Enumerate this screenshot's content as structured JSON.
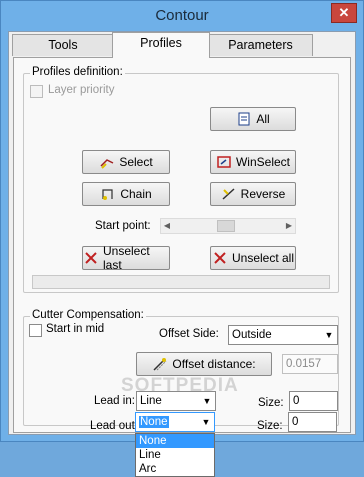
{
  "window": {
    "title": "Contour",
    "close_glyph": "✕"
  },
  "tabs": [
    {
      "label": "Tools",
      "active": false
    },
    {
      "label": "Profiles",
      "active": true
    },
    {
      "label": "Parameters",
      "active": false
    }
  ],
  "profiles": {
    "group_label": "Profiles definition:",
    "layer_priority_label": "Layer priority",
    "layer_priority_checked": false,
    "all_label": "All",
    "select_label": "Select",
    "winselect_label": "WinSelect",
    "chain_label": "Chain",
    "reverse_label": "Reverse",
    "start_point_label": "Start point:",
    "unselect_last_label": "Unselect last",
    "unselect_all_label": "Unselect all"
  },
  "cutter": {
    "group_label": "Cutter Compensation:",
    "start_in_mid_label": "Start in mid",
    "start_in_mid_checked": false,
    "offset_side_label": "Offset Side:",
    "offset_side_value": "Outside",
    "offset_distance_label": "Offset distance:",
    "offset_distance_value": "0.0157",
    "lead_in_label": "Lead in:",
    "lead_in_value": "Line",
    "lead_in_size_label": "Size:",
    "lead_in_size_value": "0",
    "lead_out_label": "Lead out:",
    "lead_out_value": "None",
    "lead_out_size_label": "Size:",
    "lead_out_size_value": "0",
    "lead_out_options": [
      "None",
      "Line",
      "Arc"
    ],
    "lead_out_selected": "None"
  },
  "watermark": "SOFTPEDIA",
  "icons": {
    "close": "close-icon",
    "all": "all-icon",
    "select": "select-icon",
    "winselect": "winselect-icon",
    "chain": "chain-icon",
    "reverse": "reverse-icon",
    "unselect_last": "unselect-last-icon",
    "unselect_all": "unselect-all-icon",
    "offset_distance": "offset-distance-icon"
  },
  "colors": {
    "titlebar": "#6fb0e8",
    "close": "#c9463d",
    "selection": "#3399ff"
  }
}
